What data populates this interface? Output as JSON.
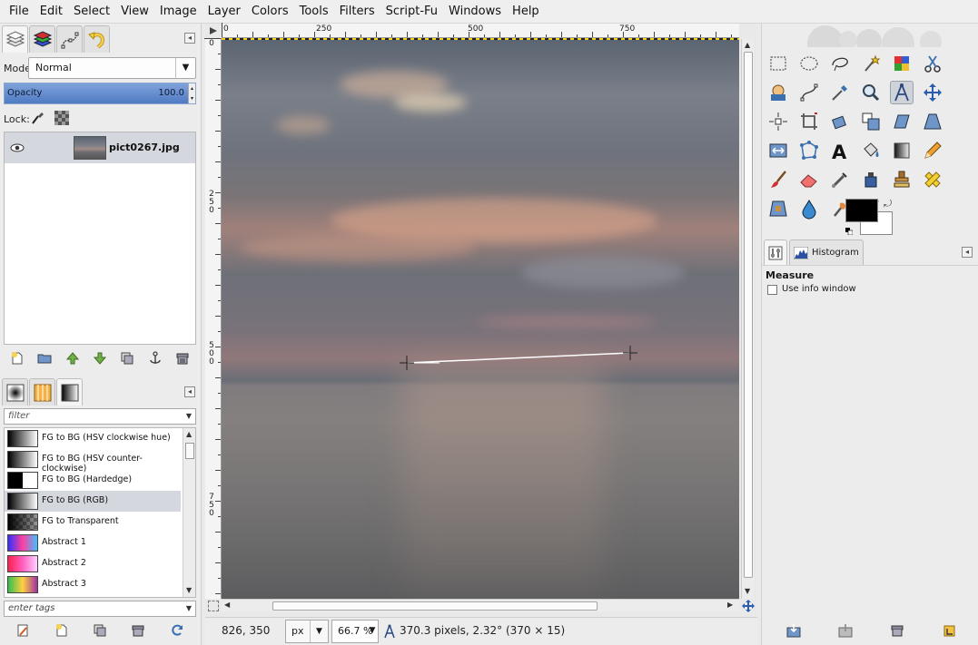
{
  "menu": [
    "File",
    "Edit",
    "Select",
    "View",
    "Image",
    "Layer",
    "Colors",
    "Tools",
    "Filters",
    "Script-Fu",
    "Windows",
    "Help"
  ],
  "layers": {
    "mode_label": "Mode:",
    "mode_value": "Normal",
    "opacity_label": "Opacity",
    "opacity_value": "100.0",
    "opacity_fraction": 1.0,
    "lock_label": "Lock:",
    "layer_name": "pict0267.jpg"
  },
  "gradients": {
    "filter_placeholder": "filter",
    "tags_placeholder": "enter tags",
    "items": [
      {
        "label": "FG to BG (HSV clockwise hue)",
        "colors": [
          "#000000",
          "#ffffff"
        ]
      },
      {
        "label": "FG to BG (HSV counter-clockwise)",
        "colors": [
          "#000000",
          "#ffffff"
        ]
      },
      {
        "label": "FG to BG (Hardedge)",
        "colors": [
          "#000000",
          "#ffffff"
        ]
      },
      {
        "label": "FG to BG (RGB)",
        "colors": [
          "#000000",
          "#ffffff"
        ]
      },
      {
        "label": "FG to Transparent",
        "colors": [
          "#000000",
          "transparent"
        ]
      },
      {
        "label": "Abstract 1",
        "colors": [
          "#3030ff",
          "#ff40a0",
          "#40c0ff"
        ]
      },
      {
        "label": "Abstract 2",
        "colors": [
          "#ff2050",
          "#ff60c0",
          "#ffd0ff"
        ]
      },
      {
        "label": "Abstract 3",
        "colors": [
          "#30c050",
          "#ffd040",
          "#a030a0"
        ]
      }
    ],
    "selected_index": 3
  },
  "ruler": {
    "top_labels": [
      "0",
      "250",
      "500",
      "750"
    ],
    "left_labels": [
      "0",
      "250",
      "500",
      "750"
    ]
  },
  "status": {
    "coords": "826, 350",
    "unit": "px",
    "zoom": "66.7 %",
    "measure": "370.3 pixels, 2.32° (370 × 15)"
  },
  "tool_options": {
    "tab_histogram": "Histogram",
    "title": "Measure",
    "checkbox_label": "Use info window",
    "checkbox_checked": false
  },
  "colors": {
    "foreground": "#000000",
    "background": "#ffffff",
    "selection_accent": "#4f7bc3"
  }
}
